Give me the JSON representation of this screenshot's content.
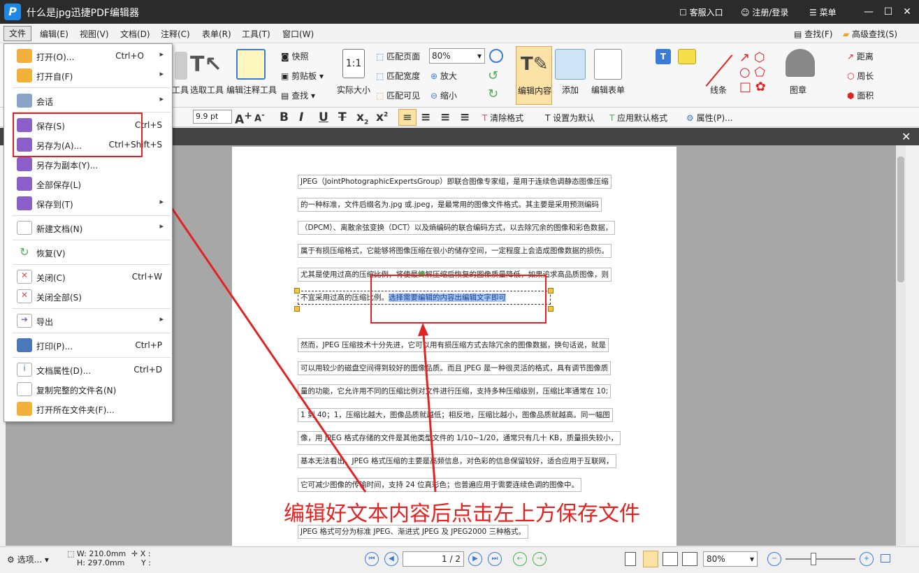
{
  "app": {
    "title": "什么是jpg迅捷PDF编辑器",
    "logo": "P",
    "service": "客服入口",
    "register": "注册/登录",
    "menu": "菜单"
  },
  "menubar": [
    "文件",
    "编辑(E)",
    "视图(V)",
    "文档(D)",
    "注释(C)",
    "表单(R)",
    "工具(T)",
    "窗口(W)"
  ],
  "menubar_right": {
    "find": "查找(F)",
    "advanced_find": "高级查找(S)"
  },
  "ribbon": {
    "tool": "工具",
    "select_text": "选取工具",
    "edit_annot": "编辑注释工具",
    "snapshot": "快照",
    "clipboard": "剪贴板",
    "find": "查找",
    "actual_size": "实际大小",
    "fit_page": "匹配页面",
    "fit_width": "匹配宽度",
    "fit_visible": "匹配可见",
    "zoom_value": "80%",
    "zoom_in": "放大",
    "zoom_out": "缩小",
    "edit_content": "编辑内容",
    "add": "添加",
    "edit_form": "编辑表单",
    "line": "线条",
    "stamp": "图章",
    "distance": "距离",
    "perimeter": "周长",
    "area": "面积"
  },
  "formatbar": {
    "font_size": "9.9 pt",
    "clear_format": "清除格式",
    "set_default": "设置为默认",
    "apply_default": "应用默认格式",
    "properties": "属性(P)..."
  },
  "file_menu": [
    {
      "label": "打开(O)...",
      "shortcut": "Ctrl+O",
      "arrow": "▸",
      "color": "#f2b13a"
    },
    {
      "label": "打开自(F)",
      "shortcut": "",
      "arrow": "▸",
      "color": "#f2b13a"
    },
    {
      "label": "会话",
      "shortcut": "",
      "arrow": "▸",
      "color": "#8aa4c8"
    },
    {
      "label": "保存(S)",
      "shortcut": "Ctrl+S",
      "arrow": "",
      "color": "#8a5fc9"
    },
    {
      "label": "另存为(A)...",
      "shortcut": "Ctrl+Shift+S",
      "arrow": "",
      "color": "#8a5fc9"
    },
    {
      "label": "另存为副本(Y)...",
      "shortcut": "",
      "arrow": "",
      "color": "#8a5fc9"
    },
    {
      "label": "全部保存(L)",
      "shortcut": "",
      "arrow": "",
      "color": "#8a5fc9"
    },
    {
      "label": "保存到(T)",
      "shortcut": "",
      "arrow": "▸",
      "color": "#8a5fc9"
    },
    {
      "label": "新建文档(N)",
      "shortcut": "",
      "arrow": "▸",
      "color": "#e0c050"
    },
    {
      "label": "恢复(V)",
      "shortcut": "",
      "arrow": "",
      "color": "#4caf50"
    },
    {
      "label": "关闭(C)",
      "shortcut": "Ctrl+W",
      "arrow": "",
      "color": "#d9534f"
    },
    {
      "label": "关闭全部(S)",
      "shortcut": "",
      "arrow": "",
      "color": "#d9534f"
    },
    {
      "label": "导出",
      "shortcut": "",
      "arrow": "▸",
      "color": "#8a5fc9"
    },
    {
      "label": "打印(P)...",
      "shortcut": "Ctrl+P",
      "arrow": "",
      "color": "#4a78b8"
    },
    {
      "label": "文档属性(D)...",
      "shortcut": "Ctrl+D",
      "arrow": "",
      "color": "#4a78b8"
    },
    {
      "label": "复制完整的文件名(N)",
      "shortcut": "",
      "arrow": "",
      "color": "#4a78b8"
    },
    {
      "label": "打开所在文件夹(F)...",
      "shortcut": "",
      "arrow": "",
      "color": "#f2b13a"
    }
  ],
  "document_lines": [
    "JPEG（JointPhotographicExpertsGroup）即联合图像专家组，是用于连续色调静态图像压缩",
    "的一种标准，文件后缀名为.jpg 或.jpeg，是最常用的图像文件格式。其主要是采用预测编码",
    "（DPCM）、离散余弦变换（DCT）以及熵编码的联合编码方式，以去除冗余的图像和彩色数据，",
    "属于有损压缩格式，它能够将图像压缩在很小的储存空间，一定程度上会造成图像数据的损伤。",
    "尤其是使用过高的压缩比例，将使最终解压缩后恢复的图像质量降低，如果追求高品质图像，则",
    "然而，JPEG 压缩技术十分先进，它可以用有损压缩方式去除冗余的图像数据，换句话说，就是",
    "可以用较少的磁盘空间得到较好的图像品质。而且 JPEG 是一种很灵活的格式，具有调节图像质",
    "量的功能，它允许用不同的压缩比例对文件进行压缩，支持多种压缩级别，压缩比率通常在 10;",
    "1 到 40；1，压缩比越大，图像品质就越低；相反地，压缩比越小，图像品质就越高。同一幅图",
    "像，用 JPEG 格式存储的文件是其他类型文件的 1/10~1/20，通常只有几十 KB，质量损失较小，",
    "基本无法看出。JPEG 格式压缩的主要是高频信息，对色彩的信息保留较好，适合应用于互联网，",
    "它可减少图像的传输时间，支持 24 位真彩色；也普遍应用于需要连续色调的图像中。",
    "JPEG 格式可分为标准 JPEG、渐进式 JPEG 及 JPEG2000 三种格式。"
  ],
  "editing_line": {
    "before": "不宜采用过高的压缩比例。",
    "selected": "选择需要编辑的内容出编辑文字即可"
  },
  "annotation": "编辑好文本内容后点击左上方保存文件",
  "statusbar": {
    "options": "选项...",
    "width": "W: 210.0mm",
    "height": "H: 297.0mm",
    "x": "X :",
    "y": "Y :",
    "page": "1 / 2",
    "zoom": "80%"
  },
  "colors": {
    "accent": "#e32222",
    "title_bg": "#2b2b2b",
    "link": "#3a7bd5"
  }
}
